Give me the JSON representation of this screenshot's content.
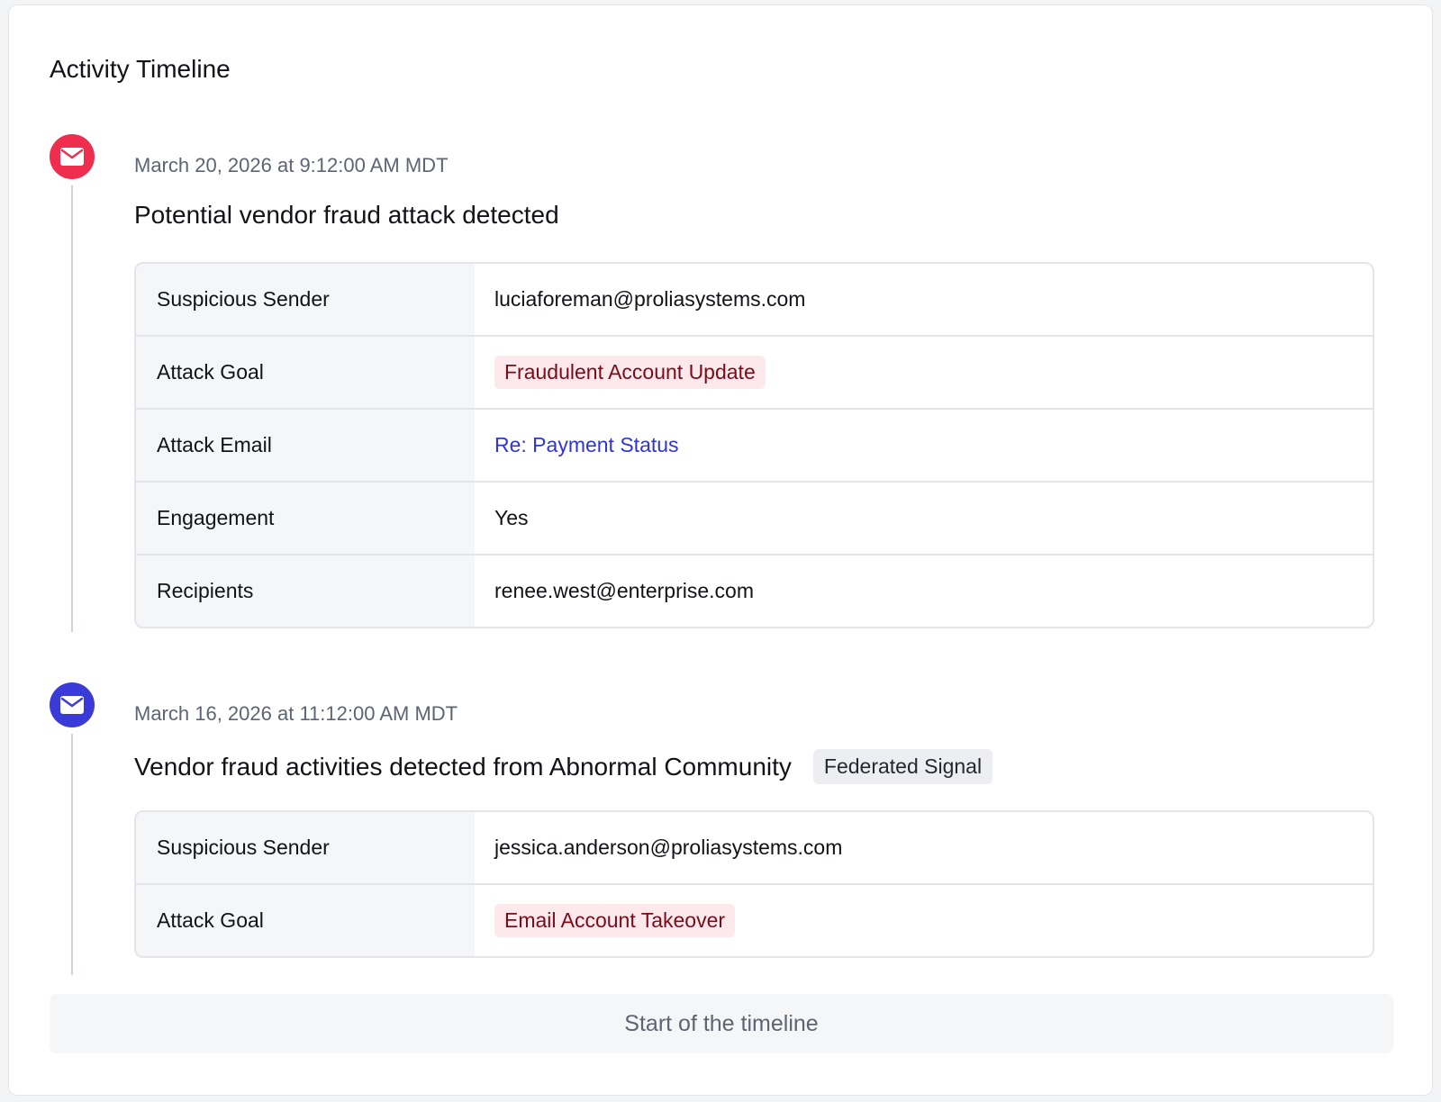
{
  "page": {
    "title": "Activity Timeline"
  },
  "colors": {
    "alert_red": "#ee2d4f",
    "info_blue": "#3a3ad8",
    "link_blue": "#2f35d6",
    "tag_red_bg": "#fde9ec",
    "tag_red_text": "#7a0c1a"
  },
  "events": [
    {
      "icon": "envelope-icon",
      "timestamp": "March 20, 2026 at 9:12:00 AM MDT",
      "heading": "Potential vendor fraud attack detected",
      "rows": [
        {
          "label": "Suspicious Sender",
          "value": "luciaforeman@proliasystems.com"
        },
        {
          "label": "Attack Goal",
          "value": "Fraudulent Account Update"
        },
        {
          "label": "Attack Email",
          "value": "Re: Payment Status"
        },
        {
          "label": "Engagement",
          "value": "Yes"
        },
        {
          "label": "Recipients",
          "value": "renee.west@enterprise.com"
        }
      ]
    },
    {
      "icon": "envelope-icon",
      "timestamp": "March 16, 2026 at 11:12:00 AM MDT",
      "heading": "Vendor fraud activities detected from Abnormal Community",
      "badge": "Federated Signal",
      "rows": [
        {
          "label": "Suspicious Sender",
          "value": "jessica.anderson@proliasystems.com"
        },
        {
          "label": "Attack Goal",
          "value": "Email Account Takeover"
        }
      ]
    }
  ],
  "footer": {
    "label": "Start of the timeline"
  }
}
